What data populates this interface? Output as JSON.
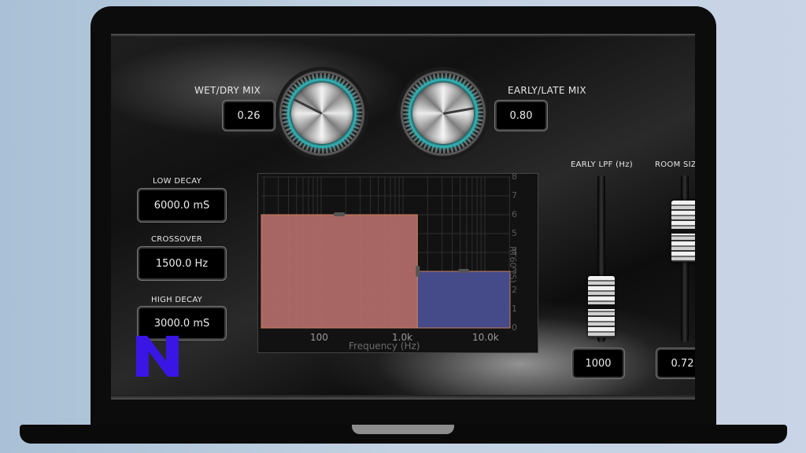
{
  "plugin": {
    "wet_dry": {
      "label": "WET/DRY MIX",
      "value": "0.26"
    },
    "early_late": {
      "label": "EARLY/LATE MIX",
      "value": "0.80"
    },
    "low_decay": {
      "label": "LOW DECAY",
      "value": "6000.0 mS"
    },
    "crossover": {
      "label": "CROSSOVER",
      "value": "1500.0 Hz"
    },
    "high_decay": {
      "label": "HIGH DECAY",
      "value": "3000.0 mS"
    },
    "early_lpf": {
      "label": "EARLY LPF (Hz)",
      "value": "1000"
    },
    "room_size": {
      "label": "ROOM SIZ",
      "value": "0.72"
    }
  },
  "graph": {
    "y_ticks": [
      "8",
      "7",
      "6",
      "5",
      "4",
      "3",
      "2",
      "1",
      "0"
    ],
    "y_label": "RT60 (S)",
    "x_ticks": [
      "100",
      "1.0k",
      "10.0k"
    ],
    "x_label": "Frequency (Hz)",
    "colors": {
      "low_band": "#b06a68",
      "high_band": "#454a88",
      "grid": "#2f2f2f"
    }
  },
  "chart_data": {
    "type": "bar",
    "categories": [
      "low",
      "high"
    ],
    "values": [
      6.0,
      3.0
    ],
    "x_crossover_hz": 1500,
    "ylabel": "RT60 (S)",
    "xlabel": "Frequency (Hz)",
    "ylim": [
      0,
      8
    ],
    "x_scale": "log"
  },
  "logo": {
    "letter": "N",
    "color": "#3a16e6"
  }
}
